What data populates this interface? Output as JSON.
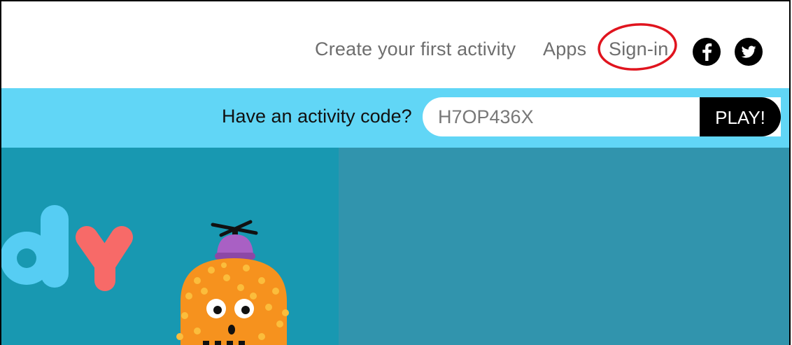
{
  "nav": {
    "create_label": "Create your first activity",
    "apps_label": "Apps",
    "signin_label": "Sign-in",
    "facebook_icon": "facebook-icon",
    "twitter_icon": "twitter-icon"
  },
  "code_bar": {
    "label": "Have an activity code?",
    "code_value": "H7OP436X",
    "play_label": "PLAY!"
  },
  "hero": {
    "logo_letters": "dy"
  },
  "colors": {
    "code_bar_bg": "#61d6f6",
    "hero_left_bg": "#1898b1",
    "hero_right_bg": "#3194ad",
    "highlight_oval": "#e0141e"
  }
}
